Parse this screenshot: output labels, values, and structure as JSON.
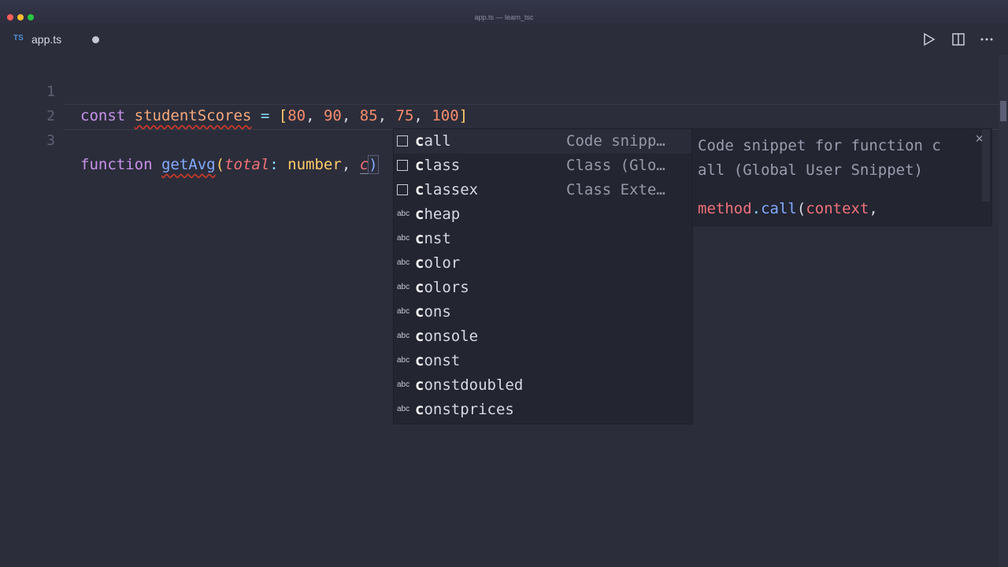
{
  "window": {
    "title": "app.ts — learn_tsc"
  },
  "tab": {
    "icon": "TS",
    "label": "app.ts"
  },
  "toolbar": {
    "run": "play-icon",
    "split": "split-editor-icon",
    "more": "more-icon"
  },
  "editor": {
    "line_numbers": [
      "1",
      "2",
      "3"
    ],
    "line1": {
      "kw": "const",
      "name": "studentScores",
      "eq": "=",
      "open": "[",
      "n1": "80",
      "n2": "90",
      "n3": "85",
      "n4": "75",
      "n5": "100",
      "close": "]",
      "sep": ", "
    },
    "line3": {
      "kw": "function",
      "name": "getAvg",
      "open": "(",
      "param": "total",
      "colon": ":",
      "type": "number",
      "comma": ",",
      "typed": "c",
      "close": ")"
    }
  },
  "suggest": {
    "items": [
      {
        "kind": "snippet",
        "prefix": "c",
        "rest": "all",
        "detail": "Code snipp…"
      },
      {
        "kind": "snippet",
        "prefix": "c",
        "rest": "lass",
        "detail": "Class (Glo…"
      },
      {
        "kind": "snippet",
        "prefix": "c",
        "rest": "lassex",
        "detail": "Class Exte…"
      },
      {
        "kind": "abc",
        "prefix": "c",
        "rest": "heap",
        "detail": ""
      },
      {
        "kind": "abc",
        "prefix": "c",
        "rest": "nst",
        "detail": ""
      },
      {
        "kind": "abc",
        "prefix": "c",
        "rest": "olor",
        "detail": ""
      },
      {
        "kind": "abc",
        "prefix": "c",
        "rest": "olors",
        "detail": ""
      },
      {
        "kind": "abc",
        "prefix": "c",
        "rest": "ons",
        "detail": ""
      },
      {
        "kind": "abc",
        "prefix": "c",
        "rest": "onsole",
        "detail": ""
      },
      {
        "kind": "abc",
        "prefix": "c",
        "rest": "onst",
        "detail": ""
      },
      {
        "kind": "abc",
        "prefix": "c",
        "rest": "onstdoubled",
        "detail": ""
      },
      {
        "kind": "abc",
        "prefix": "c",
        "rest": "onstprices",
        "detail": ""
      }
    ],
    "abc_label": "abc"
  },
  "details": {
    "description": "Code snippet for function c\nall (Global User Snippet)",
    "code_obj": "method",
    "code_dot": ".",
    "code_fn": "call",
    "code_open": "(",
    "code_arg": "context",
    "code_comma": ",",
    "close": "×"
  }
}
